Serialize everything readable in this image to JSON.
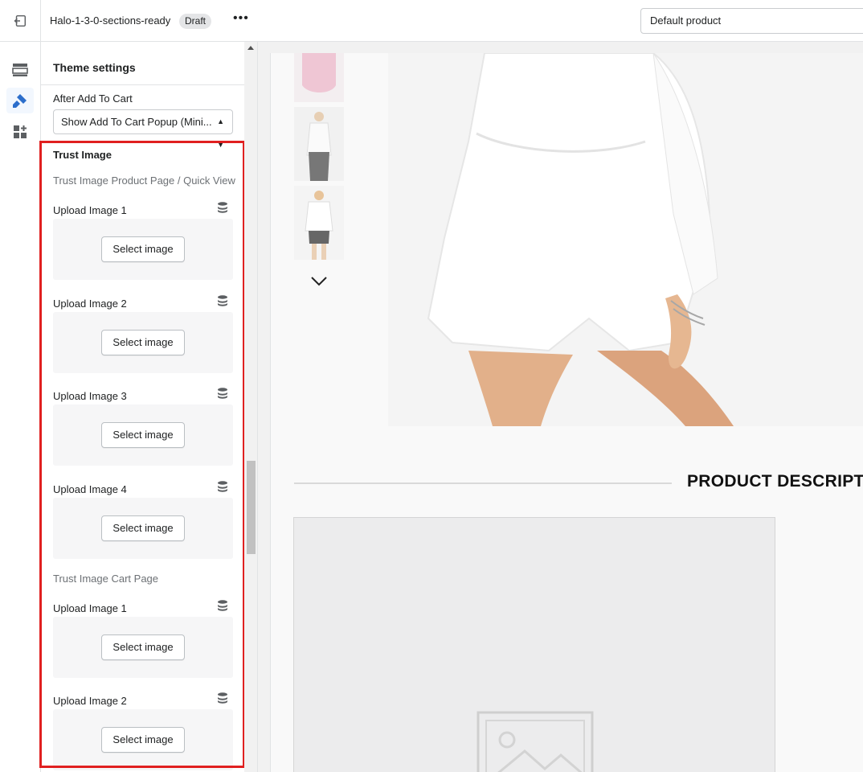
{
  "topbar": {
    "theme_name": "Halo-1-3-0-sections-ready",
    "status_badge": "Draft",
    "more_label": "•••",
    "template_select": "Default product"
  },
  "rail": {
    "items": [
      {
        "icon": "sections-icon"
      },
      {
        "icon": "theme-settings-brush-icon",
        "active": true
      },
      {
        "icon": "apps-add-icon"
      }
    ]
  },
  "panel": {
    "title": "Theme settings",
    "after_add_to_cart": {
      "label": "After Add To Cart",
      "value": "Show Add To Cart Popup (Mini..."
    },
    "trust_image": {
      "heading": "Trust Image",
      "product_page_heading": "Trust Image Product Page / Quick View",
      "product_page_uploads": [
        {
          "label": "Upload Image 1",
          "button": "Select image"
        },
        {
          "label": "Upload Image 2",
          "button": "Select image"
        },
        {
          "label": "Upload Image 3",
          "button": "Select image"
        },
        {
          "label": "Upload Image 4",
          "button": "Select image"
        }
      ],
      "cart_page_heading": "Trust Image Cart Page",
      "cart_page_uploads": [
        {
          "label": "Upload Image 1",
          "button": "Select image"
        },
        {
          "label": "Upload Image 2",
          "button": "Select image"
        }
      ]
    },
    "highlight_color": "#e02020"
  },
  "preview": {
    "description_title": "PRODUCT DESCRIPTI"
  }
}
